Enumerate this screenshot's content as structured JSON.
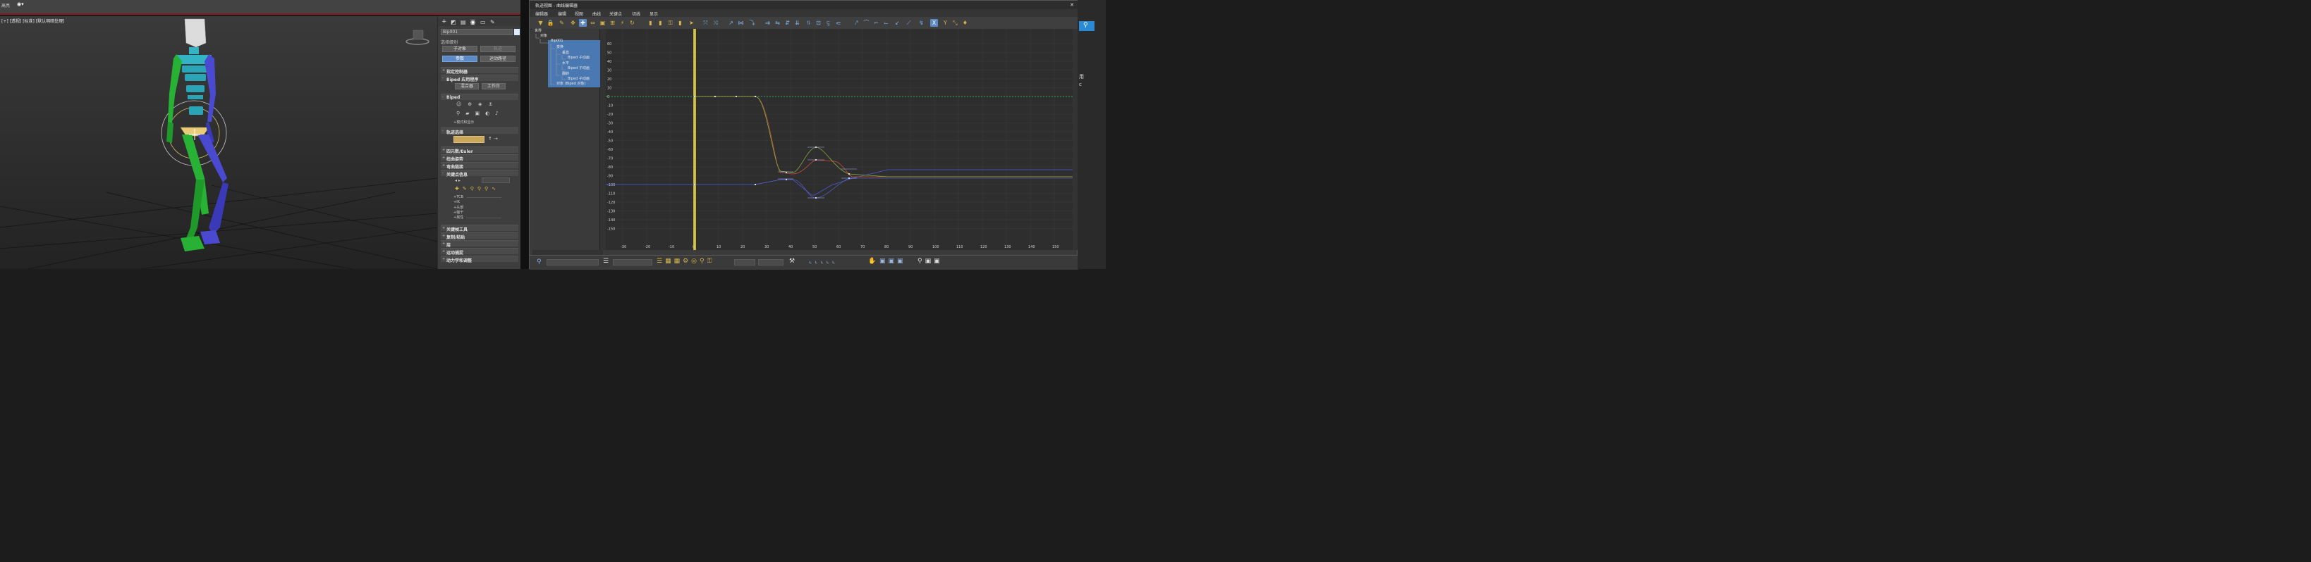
{
  "topbar": {
    "left_label": "高亮"
  },
  "viewport": {
    "label": "[+] [透视] [标准] [默认明暗处理]"
  },
  "cmd": {
    "name_value": "Bip001",
    "sel_level_label": "选择级别",
    "sub_object_btn": "子对象",
    "dummy_btn": "轨迹",
    "params_btn": "参数",
    "motion_path_btn": "运动路径",
    "rollouts": [
      {
        "label": "指定控制器",
        "sign": "+"
      },
      {
        "label": "Biped 应用程序",
        "sign": "-"
      },
      {
        "label": "Biped",
        "sign": "-"
      },
      {
        "label": "轨迹选择",
        "sign": "-"
      },
      {
        "label": "四元数/Euler",
        "sign": "+"
      },
      {
        "label": "扭曲姿势",
        "sign": "+"
      },
      {
        "label": "弯曲链接",
        "sign": "+"
      },
      {
        "label": "关键点信息",
        "sign": "-"
      },
      {
        "label": "关键帧工具",
        "sign": "+"
      },
      {
        "label": "复制/粘贴",
        "sign": "+"
      },
      {
        "label": "层",
        "sign": "+"
      },
      {
        "label": "运动捕捉",
        "sign": "+"
      },
      {
        "label": "动力学和调整",
        "sign": "+"
      }
    ],
    "mixer_btn": "混合器",
    "workbench_btn": "工作台",
    "mode_label": "+模式和显示",
    "key_props": [
      "+TCB",
      "+IK",
      "+头部",
      "+躯干",
      "+属性"
    ]
  },
  "trackview": {
    "title": "轨迹视图 - 曲线编辑器",
    "menu": [
      "编辑器",
      "编辑",
      "视图",
      "曲线",
      "关键点",
      "切线",
      "显示"
    ],
    "tree": [
      {
        "label": "世界",
        "level": 0
      },
      {
        "label": "对象",
        "level": 1
      },
      {
        "label": "Bip001",
        "level": 2
      },
      {
        "label": "变换",
        "level": 3
      },
      {
        "label": "垂直",
        "level": 4
      },
      {
        "label": "Biped 子动画",
        "level": 5
      },
      {
        "label": "水平",
        "level": 4
      },
      {
        "label": "Biped 子动画",
        "level": 5
      },
      {
        "label": "翻转",
        "level": 4
      },
      {
        "label": "Biped 子动画",
        "level": 5
      },
      {
        "label": "对象 (Biped 对象)",
        "level": 3
      }
    ],
    "y_ticks": [
      60,
      50,
      40,
      30,
      20,
      10,
      0,
      -10,
      -20,
      -30,
      -40,
      -50,
      -60,
      -70,
      -80,
      -90,
      -100,
      -110,
      -120,
      -130,
      -140,
      -150
    ],
    "x_ticks": [
      -30,
      -20,
      -10,
      0,
      10,
      20,
      30,
      40,
      50,
      60,
      70,
      80,
      90,
      100,
      110,
      120,
      130,
      140,
      150
    ],
    "current_frame": 0
  },
  "right_edge": {
    "label1": "用",
    "label2": "c"
  }
}
